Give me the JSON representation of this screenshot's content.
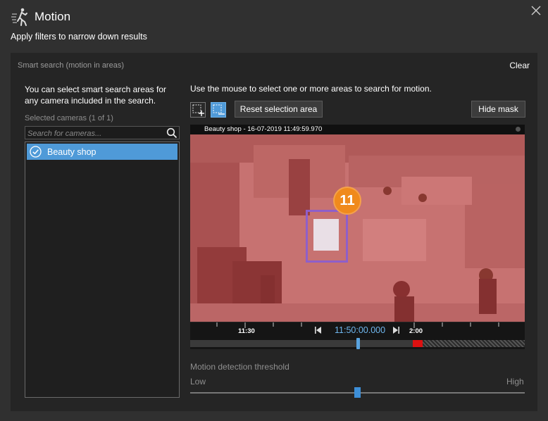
{
  "dialog": {
    "title": "Motion",
    "subtitle": "Apply filters to narrow down results",
    "icon": "running-person-icon",
    "close_icon": "close-icon"
  },
  "smart_search": {
    "label": "Smart search (motion in areas)",
    "clear_label": "Clear",
    "left_description": "You can select smart search areas for any camera included in the search.",
    "selected_cameras_label": "Selected cameras (1 of 1)",
    "search_placeholder": "Search for cameras...",
    "cameras": [
      {
        "name": "Beauty shop",
        "selected": true
      }
    ],
    "right_description": "Use the mouse to select one or more areas to search for motion.",
    "reset_label": "Reset selection area",
    "hide_mask_label": "Hide mask",
    "tools": [
      "add-area-icon",
      "remove-area-icon"
    ]
  },
  "video": {
    "caption": "Beauty shop - 16-07-2019 11:49:59.970",
    "badge": "11",
    "mask_color": "#cd3c3c",
    "selection_color": "#8f5fc9",
    "badge_color": "#f08a1c"
  },
  "timeline": {
    "left_label": "11:30",
    "current_time": "11:50:00.000",
    "right_label": "2:00",
    "accent_color": "#6fb6ee"
  },
  "threshold": {
    "label": "Motion detection threshold",
    "low_label": "Low",
    "high_label": "High",
    "value": 0.5
  }
}
